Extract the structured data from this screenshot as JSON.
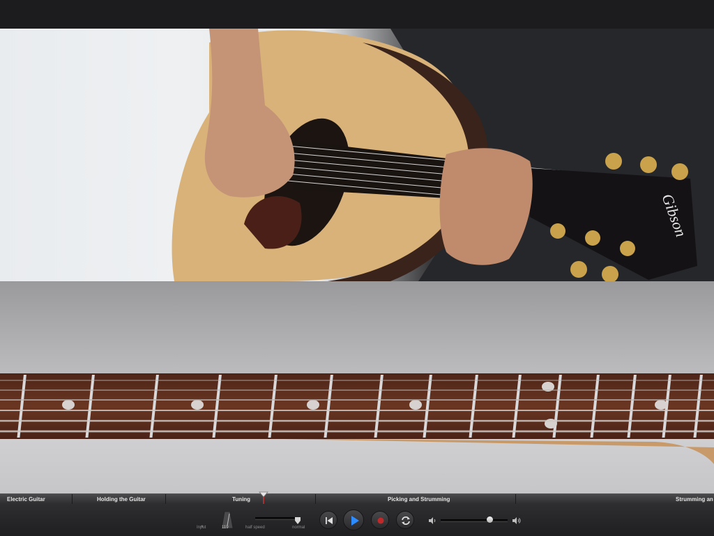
{
  "lesson": {
    "chapters": [
      {
        "label": "Electric Guitar"
      },
      {
        "label": "Holding the Guitar"
      },
      {
        "label": "Tuning"
      },
      {
        "label": "Picking and Strumming"
      },
      {
        "label": "Strumming an E"
      }
    ]
  },
  "transport": {
    "input_label": "Input",
    "tempo_value": "119",
    "speed_slow_label": "half speed",
    "speed_normal_label": "normal",
    "speed_level": 0.95,
    "volume_level": 0.73
  },
  "video": {
    "headstock_brand": "Gibson"
  },
  "colors": {
    "accent_blue": "#2d8cff",
    "record_red": "#c0282a",
    "fretboard_wood": "#5a2e1e"
  }
}
